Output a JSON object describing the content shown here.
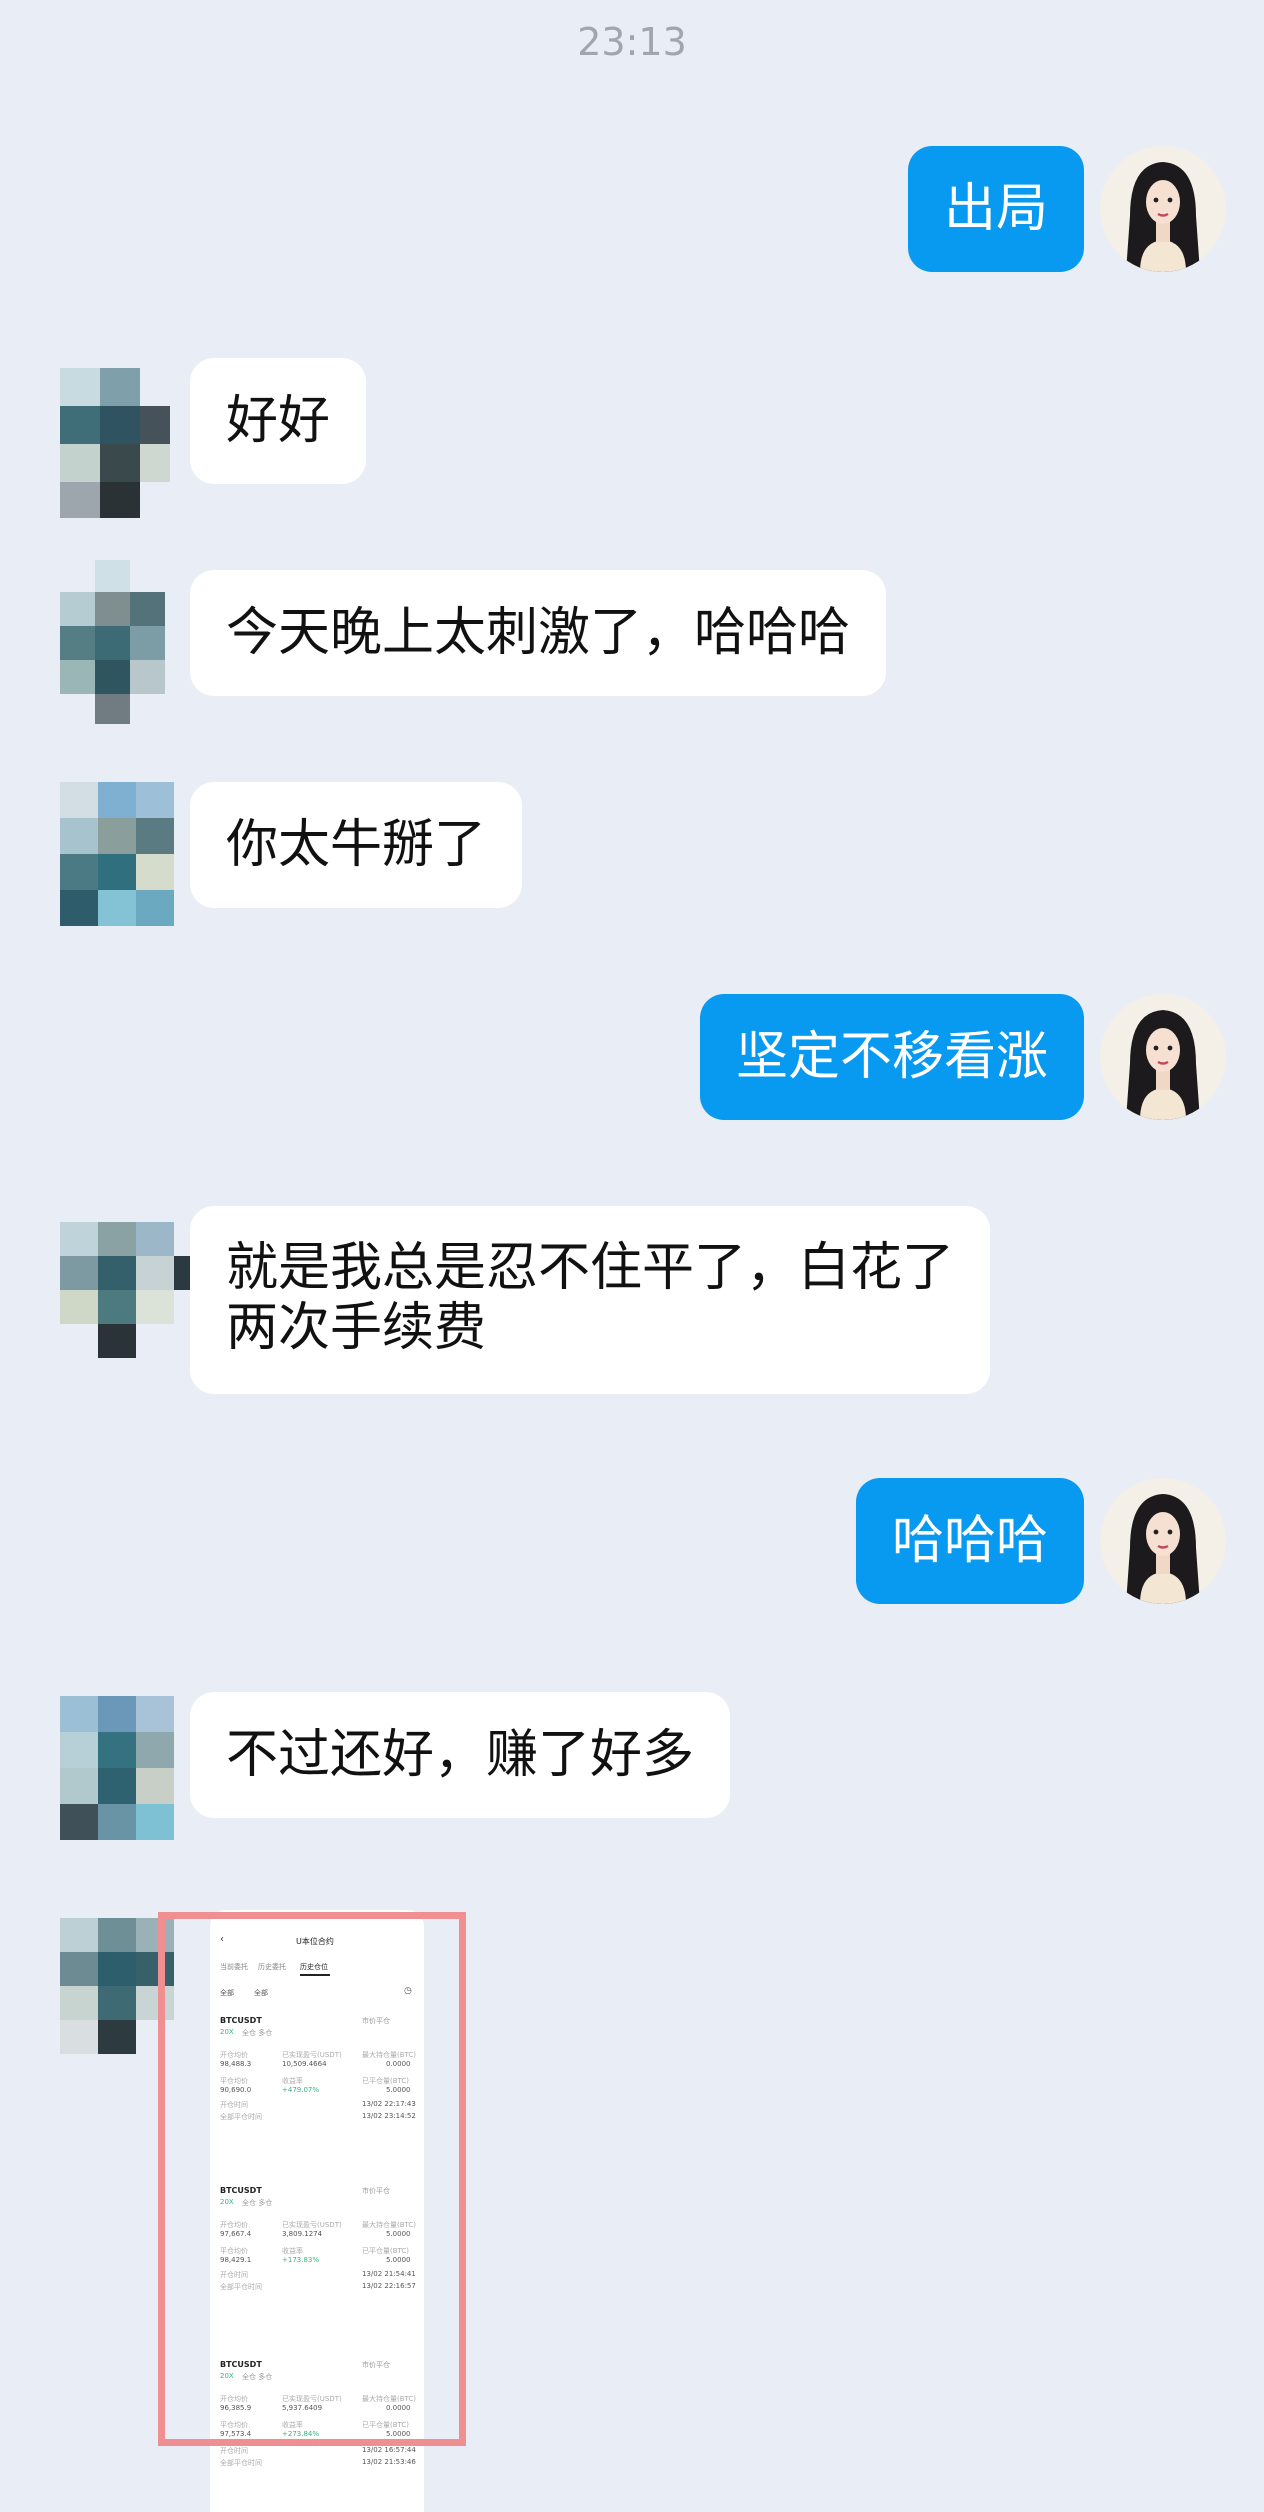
{
  "timestamp": "23:13",
  "messages": [
    {
      "side": "out",
      "text": "出局"
    },
    {
      "side": "in",
      "text": "好好"
    },
    {
      "side": "in",
      "text": "今天晚上太刺激了，哈哈哈"
    },
    {
      "side": "in",
      "text": "你太牛掰了"
    },
    {
      "side": "out",
      "text": "坚定不移看涨"
    },
    {
      "side": "in",
      "lines": [
        "就是我总是忍不住平了，白花了",
        "两次手续费"
      ]
    },
    {
      "side": "out",
      "text": "哈哈哈"
    },
    {
      "side": "in",
      "text": "不过还好，赚了好多"
    }
  ],
  "screenshot": {
    "title": "U本位合约",
    "tabs": [
      "当前委托",
      "历史委托",
      "历史仓位"
    ],
    "filters": [
      "全部",
      "全部"
    ],
    "positions": [
      {
        "symbol": "BTCUSDT",
        "status": "市价平仓",
        "tag": "20X",
        "type": "全仓 多仓",
        "row1": [
          "98,488.3",
          "10,509.4664",
          "0.0000"
        ],
        "row2": [
          "90,690.0",
          "+479.07%",
          "5.0000"
        ],
        "open_time": "13/02 22:17:43",
        "close_time": "13/02 23:14:52"
      },
      {
        "symbol": "BTCUSDT",
        "status": "市价平仓",
        "tag": "20X",
        "type": "全仓 多仓",
        "row1": [
          "97,667.4",
          "3,809.1274",
          "5.0000"
        ],
        "row2": [
          "98,429.1",
          "+173.83%",
          "5.0000"
        ],
        "open_time": "13/02 21:54:41",
        "close_time": "13/02 22:16:57"
      },
      {
        "symbol": "BTCUSDT",
        "status": "市价平仓",
        "tag": "20X",
        "type": "全仓 多仓",
        "row1": [
          "96,385.9",
          "5,937.6409",
          "0.0000"
        ],
        "row2": [
          "97,573.4",
          "+273.84%",
          "5.0000"
        ],
        "open_time": "13/02 16:57:44",
        "close_time": "13/02 21:53:46"
      }
    ],
    "labels": {
      "open_price": "开仓均价",
      "pnl": "已实现盈亏(USDT)",
      "max": "最大持仓量(BTC)",
      "close_price": "平仓均价",
      "roi": "收益率",
      "closed": "已平仓量(BTC)",
      "open_time": "开仓时间",
      "close_time": "全部平仓时间"
    }
  }
}
